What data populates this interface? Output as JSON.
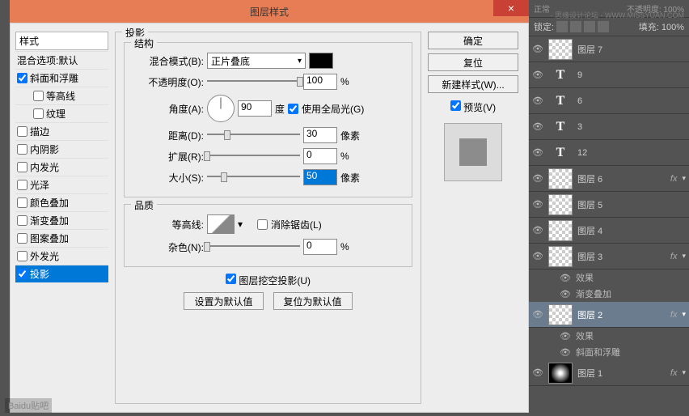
{
  "dialog": {
    "title": "图层样式",
    "close": "×",
    "styles_header": "样式",
    "blend_default": "混合选项:默认",
    "styles": [
      {
        "label": "斜面和浮雕",
        "checked": true
      },
      {
        "label": "等高线",
        "checked": false,
        "indent": true
      },
      {
        "label": "纹理",
        "checked": false,
        "indent": true
      },
      {
        "label": "描边",
        "checked": false
      },
      {
        "label": "内阴影",
        "checked": false
      },
      {
        "label": "内发光",
        "checked": false
      },
      {
        "label": "光泽",
        "checked": false
      },
      {
        "label": "颜色叠加",
        "checked": false
      },
      {
        "label": "渐变叠加",
        "checked": false
      },
      {
        "label": "图案叠加",
        "checked": false
      },
      {
        "label": "外发光",
        "checked": false
      },
      {
        "label": "投影",
        "checked": true,
        "selected": true
      }
    ],
    "section_shadow": "投影",
    "section_structure": "结构",
    "section_quality": "品质",
    "blend_mode_label": "混合模式(B):",
    "blend_mode_value": "正片叠底",
    "opacity_label": "不透明度(O):",
    "opacity_value": "100",
    "percent": "%",
    "angle_label": "角度(A):",
    "angle_value": "90",
    "degree": "度",
    "global_light": "使用全局光(G)",
    "distance_label": "距离(D):",
    "distance_value": "30",
    "px": "像素",
    "spread_label": "扩展(R):",
    "spread_value": "0",
    "size_label": "大小(S):",
    "size_value": "50",
    "contour_label": "等高线:",
    "antialias": "消除锯齿(L)",
    "noise_label": "杂色(N):",
    "noise_value": "0",
    "knockout": "图层挖空投影(U)",
    "reset_default": "设置为默认值",
    "restore_default": "复位为默认值",
    "ok": "确定",
    "cancel": "复位",
    "new_style": "新建样式(W)...",
    "preview": "预览(V)"
  },
  "layers": {
    "top_label": "正常",
    "opacity_label": "不透明度:",
    "fill_label": "填充:",
    "pct": "100%",
    "lock_label": "锁定:",
    "items": [
      {
        "name": "图层 7",
        "type": "bitmap"
      },
      {
        "name": "9",
        "type": "text"
      },
      {
        "name": "6",
        "type": "text"
      },
      {
        "name": "3",
        "type": "text"
      },
      {
        "name": "12",
        "type": "text"
      },
      {
        "name": "图层 6",
        "type": "bitmap",
        "fx": true
      },
      {
        "name": "图层 5",
        "type": "bitmap"
      },
      {
        "name": "图层 4",
        "type": "bitmap"
      },
      {
        "name": "图层 3",
        "type": "bitmap",
        "fx": true,
        "effects": [
          "效果",
          "渐变叠加"
        ]
      },
      {
        "name": "图层 2",
        "type": "bitmap",
        "fx": true,
        "selected": true,
        "effects": [
          "效果",
          "斜面和浮雕"
        ]
      },
      {
        "name": "图层 1",
        "type": "radial",
        "fx": true
      }
    ],
    "fx_label": "fx"
  },
  "watermark1": "- 思缘设计论坛 - WWW.MISSYUAN.COM",
  "watermark2": "Baidu贴吧"
}
